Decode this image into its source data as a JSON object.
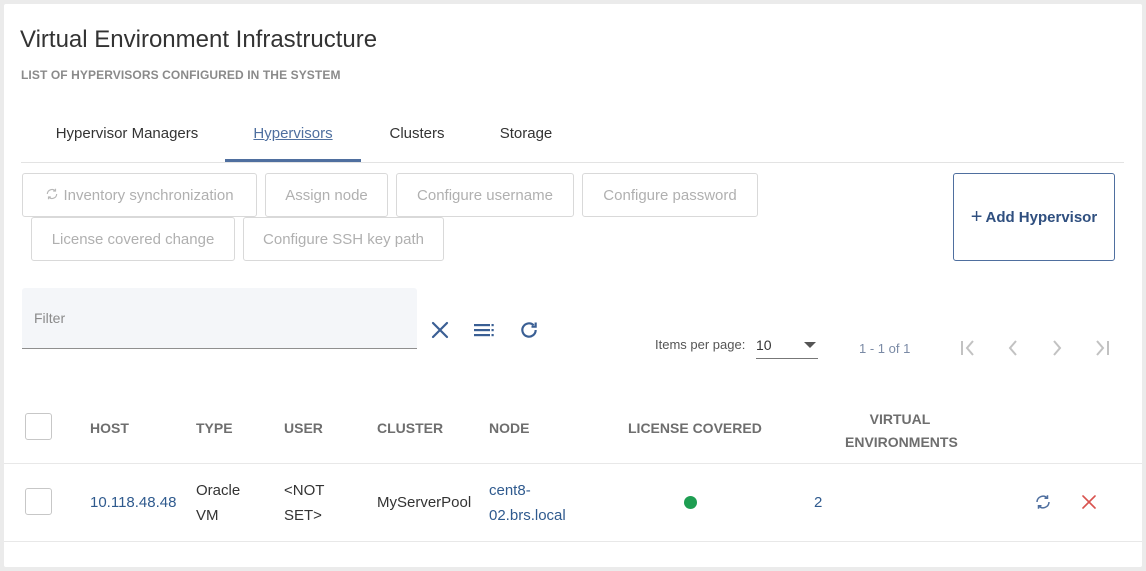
{
  "page": {
    "title": "Virtual Environment Infrastructure",
    "subtitle": "LIST OF HYPERVISORS CONFIGURED IN THE SYSTEM"
  },
  "tabs": [
    {
      "label": "Hypervisor Managers",
      "active": false
    },
    {
      "label": "Hypervisors",
      "active": true
    },
    {
      "label": "Clusters",
      "active": false
    },
    {
      "label": "Storage",
      "active": false
    }
  ],
  "actions": {
    "inventory_sync": "Inventory synchronization",
    "assign_node": "Assign node",
    "configure_username": "Configure username",
    "configure_password": "Configure password",
    "license_change": "License covered change",
    "configure_ssh": "Configure SSH key path",
    "add_hypervisor": "Add Hypervisor"
  },
  "filter": {
    "placeholder": "Filter",
    "value": ""
  },
  "toolbar_icons": [
    "close-icon",
    "list-icon",
    "refresh-icon"
  ],
  "pager": {
    "items_per_page_label": "Items per page:",
    "items_per_page_value": "10",
    "range": "1 - 1 of 1"
  },
  "table": {
    "columns": {
      "host": "HOST",
      "type": "TYPE",
      "user": "USER",
      "cluster": "CLUSTER",
      "node": "NODE",
      "license": "LICENSE COVERED",
      "virtual_env_line1": "VIRTUAL",
      "virtual_env_line2": "ENVIRONMENTS"
    },
    "rows": [
      {
        "host": "10.118.48.48",
        "type_line1": "Oracle",
        "type_line2": "VM",
        "user_line1": "<NOT",
        "user_line2": "SET>",
        "cluster": "MyServerPool",
        "node_line1": "cent8-",
        "node_line2": "02.brs.local",
        "license_covered": true,
        "virtual_environments": "2"
      }
    ]
  },
  "colors": {
    "accent": "#4f6f9f",
    "link": "#2f5a8e",
    "license_ok": "#1e9e52",
    "delete": "#d9534f"
  }
}
